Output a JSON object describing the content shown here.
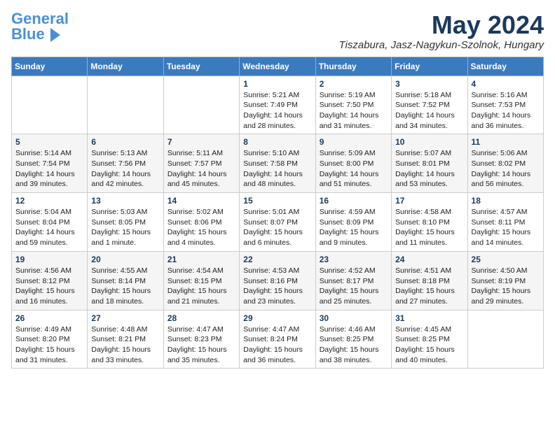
{
  "header": {
    "logo_line1": "General",
    "logo_line2": "Blue",
    "month": "May 2024",
    "location": "Tiszabura, Jasz-Nagykun-Szolnok, Hungary"
  },
  "weekdays": [
    "Sunday",
    "Monday",
    "Tuesday",
    "Wednesday",
    "Thursday",
    "Friday",
    "Saturday"
  ],
  "weeks": [
    [
      {
        "day": "",
        "info": ""
      },
      {
        "day": "",
        "info": ""
      },
      {
        "day": "",
        "info": ""
      },
      {
        "day": "1",
        "info": "Sunrise: 5:21 AM\nSunset: 7:49 PM\nDaylight: 14 hours\nand 28 minutes."
      },
      {
        "day": "2",
        "info": "Sunrise: 5:19 AM\nSunset: 7:50 PM\nDaylight: 14 hours\nand 31 minutes."
      },
      {
        "day": "3",
        "info": "Sunrise: 5:18 AM\nSunset: 7:52 PM\nDaylight: 14 hours\nand 34 minutes."
      },
      {
        "day": "4",
        "info": "Sunrise: 5:16 AM\nSunset: 7:53 PM\nDaylight: 14 hours\nand 36 minutes."
      }
    ],
    [
      {
        "day": "5",
        "info": "Sunrise: 5:14 AM\nSunset: 7:54 PM\nDaylight: 14 hours\nand 39 minutes."
      },
      {
        "day": "6",
        "info": "Sunrise: 5:13 AM\nSunset: 7:56 PM\nDaylight: 14 hours\nand 42 minutes."
      },
      {
        "day": "7",
        "info": "Sunrise: 5:11 AM\nSunset: 7:57 PM\nDaylight: 14 hours\nand 45 minutes."
      },
      {
        "day": "8",
        "info": "Sunrise: 5:10 AM\nSunset: 7:58 PM\nDaylight: 14 hours\nand 48 minutes."
      },
      {
        "day": "9",
        "info": "Sunrise: 5:09 AM\nSunset: 8:00 PM\nDaylight: 14 hours\nand 51 minutes."
      },
      {
        "day": "10",
        "info": "Sunrise: 5:07 AM\nSunset: 8:01 PM\nDaylight: 14 hours\nand 53 minutes."
      },
      {
        "day": "11",
        "info": "Sunrise: 5:06 AM\nSunset: 8:02 PM\nDaylight: 14 hours\nand 56 minutes."
      }
    ],
    [
      {
        "day": "12",
        "info": "Sunrise: 5:04 AM\nSunset: 8:04 PM\nDaylight: 14 hours\nand 59 minutes."
      },
      {
        "day": "13",
        "info": "Sunrise: 5:03 AM\nSunset: 8:05 PM\nDaylight: 15 hours\nand 1 minute."
      },
      {
        "day": "14",
        "info": "Sunrise: 5:02 AM\nSunset: 8:06 PM\nDaylight: 15 hours\nand 4 minutes."
      },
      {
        "day": "15",
        "info": "Sunrise: 5:01 AM\nSunset: 8:07 PM\nDaylight: 15 hours\nand 6 minutes."
      },
      {
        "day": "16",
        "info": "Sunrise: 4:59 AM\nSunset: 8:09 PM\nDaylight: 15 hours\nand 9 minutes."
      },
      {
        "day": "17",
        "info": "Sunrise: 4:58 AM\nSunset: 8:10 PM\nDaylight: 15 hours\nand 11 minutes."
      },
      {
        "day": "18",
        "info": "Sunrise: 4:57 AM\nSunset: 8:11 PM\nDaylight: 15 hours\nand 14 minutes."
      }
    ],
    [
      {
        "day": "19",
        "info": "Sunrise: 4:56 AM\nSunset: 8:12 PM\nDaylight: 15 hours\nand 16 minutes."
      },
      {
        "day": "20",
        "info": "Sunrise: 4:55 AM\nSunset: 8:14 PM\nDaylight: 15 hours\nand 18 minutes."
      },
      {
        "day": "21",
        "info": "Sunrise: 4:54 AM\nSunset: 8:15 PM\nDaylight: 15 hours\nand 21 minutes."
      },
      {
        "day": "22",
        "info": "Sunrise: 4:53 AM\nSunset: 8:16 PM\nDaylight: 15 hours\nand 23 minutes."
      },
      {
        "day": "23",
        "info": "Sunrise: 4:52 AM\nSunset: 8:17 PM\nDaylight: 15 hours\nand 25 minutes."
      },
      {
        "day": "24",
        "info": "Sunrise: 4:51 AM\nSunset: 8:18 PM\nDaylight: 15 hours\nand 27 minutes."
      },
      {
        "day": "25",
        "info": "Sunrise: 4:50 AM\nSunset: 8:19 PM\nDaylight: 15 hours\nand 29 minutes."
      }
    ],
    [
      {
        "day": "26",
        "info": "Sunrise: 4:49 AM\nSunset: 8:20 PM\nDaylight: 15 hours\nand 31 minutes."
      },
      {
        "day": "27",
        "info": "Sunrise: 4:48 AM\nSunset: 8:21 PM\nDaylight: 15 hours\nand 33 minutes."
      },
      {
        "day": "28",
        "info": "Sunrise: 4:47 AM\nSunset: 8:23 PM\nDaylight: 15 hours\nand 35 minutes."
      },
      {
        "day": "29",
        "info": "Sunrise: 4:47 AM\nSunset: 8:24 PM\nDaylight: 15 hours\nand 36 minutes."
      },
      {
        "day": "30",
        "info": "Sunrise: 4:46 AM\nSunset: 8:25 PM\nDaylight: 15 hours\nand 38 minutes."
      },
      {
        "day": "31",
        "info": "Sunrise: 4:45 AM\nSunset: 8:25 PM\nDaylight: 15 hours\nand 40 minutes."
      },
      {
        "day": "",
        "info": ""
      }
    ]
  ]
}
